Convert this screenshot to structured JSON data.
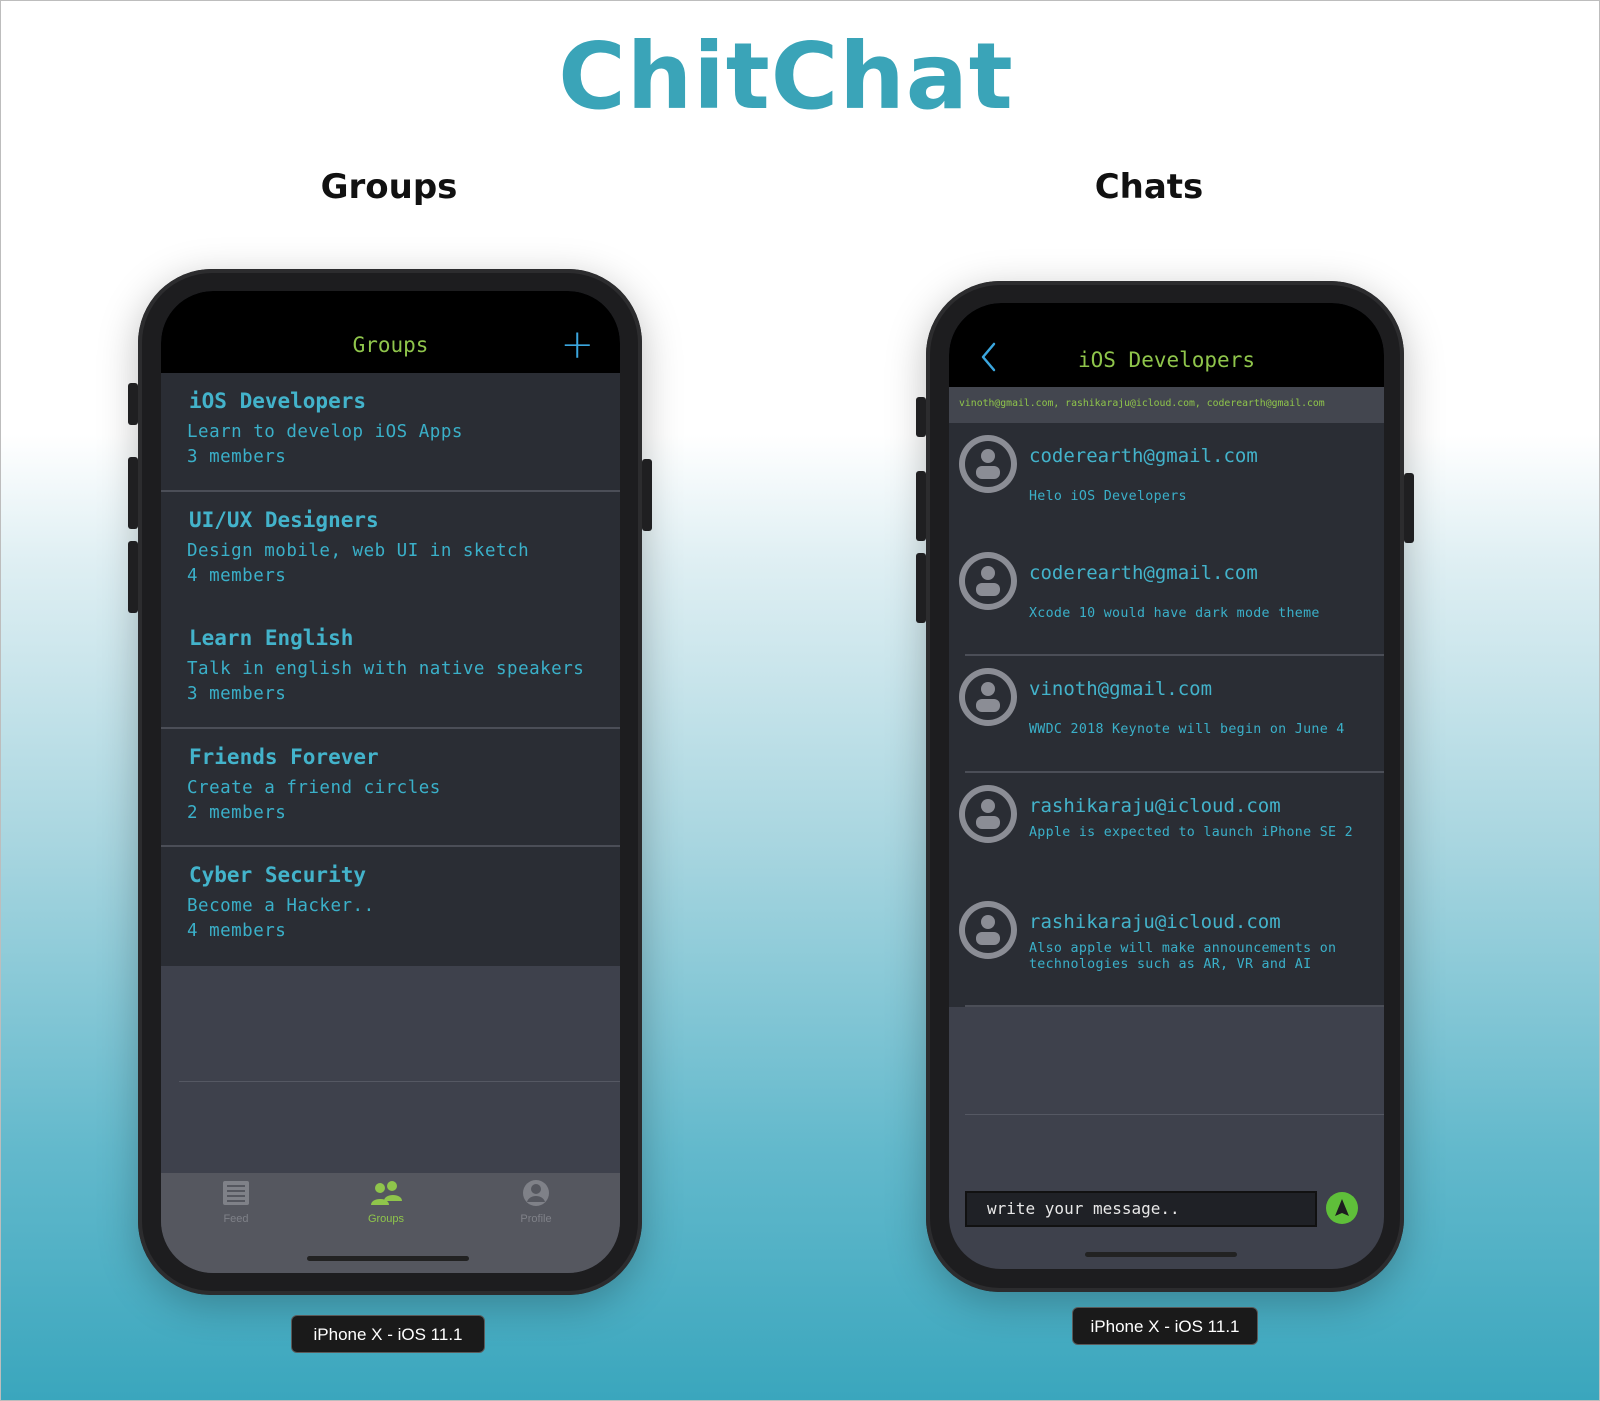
{
  "app_title": "ChitChat",
  "sections": {
    "left_title": "Groups",
    "right_title": "Chats"
  },
  "device_caption": "iPhone X - iOS 11.1",
  "groups_screen": {
    "nav_title": "Groups",
    "add_label": "+",
    "groups": [
      {
        "name": "iOS Developers",
        "description": "Learn to develop iOS Apps",
        "members": "3 members"
      },
      {
        "name": "UI/UX Designers",
        "description": "Design mobile, web UI in sketch",
        "members": "4 members"
      },
      {
        "name": "Learn English",
        "description": "Talk in english with native speakers",
        "members": "3 members"
      },
      {
        "name": "Friends Forever",
        "description": "Create a friend circles",
        "members": "2 members"
      },
      {
        "name": "Cyber Security",
        "description": "Become a Hacker..",
        "members": "4 members"
      }
    ],
    "tabs": [
      {
        "label": "Feed",
        "icon": "feed-icon",
        "active": false
      },
      {
        "label": "Groups",
        "icon": "groups-icon",
        "active": true
      },
      {
        "label": "Profile",
        "icon": "profile-icon",
        "active": false
      }
    ],
    "colors": {
      "accent_green": "#8fc54b",
      "accent_blue": "#43b3cb",
      "tab_inactive": "#7f8188"
    }
  },
  "chat_screen": {
    "nav_title": "iOS Developers",
    "members_line": "vinoth@gmail.com, rashikaraju@icloud.com, coderearth@gmail.com",
    "messages": [
      {
        "sender": "coderearth@gmail.com",
        "text": "Helo iOS Developers"
      },
      {
        "sender": "coderearth@gmail.com",
        "text": "Xcode 10 would have dark mode theme"
      },
      {
        "sender": "vinoth@gmail.com",
        "text": "WWDC 2018 Keynote will begin on June 4"
      },
      {
        "sender": "rashikaraju@icloud.com",
        "text": "Apple is expected to launch iPhone SE 2"
      },
      {
        "sender": "rashikaraju@icloud.com",
        "text": "Also apple will make announcements on technologies such as AR, VR and AI"
      }
    ],
    "input_value": "write your message..",
    "colors": {
      "send_button": "#5fbf3a"
    }
  }
}
